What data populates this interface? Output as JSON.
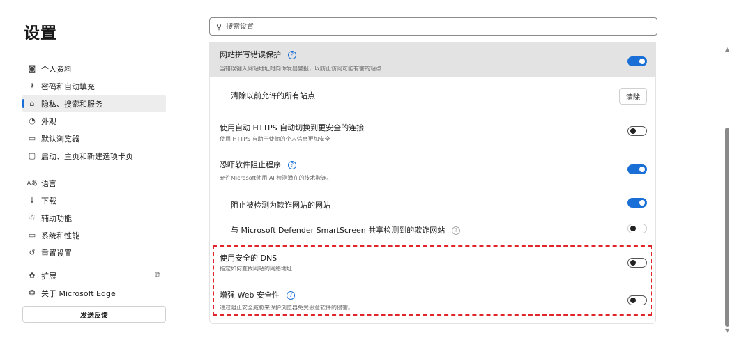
{
  "app": {
    "title": "设置"
  },
  "sidebar": {
    "items": [
      {
        "label": "个人资料",
        "icon": "profile-icon",
        "glyph": "◙"
      },
      {
        "label": "密码和自动填充",
        "icon": "key-icon",
        "glyph": "⚷"
      },
      {
        "label": "隐私、搜索和服务",
        "icon": "lock-icon",
        "glyph": "⌂",
        "active": true
      },
      {
        "label": "外观",
        "icon": "appearance-icon",
        "glyph": "◔"
      },
      {
        "label": "默认浏览器",
        "icon": "browser-icon",
        "glyph": "▭"
      },
      {
        "label": "启动、主页和新建选项卡页",
        "icon": "home-tab-icon",
        "glyph": "▢"
      },
      {
        "label": "语言",
        "icon": "language-icon",
        "glyph": "Aあ"
      },
      {
        "label": "下载",
        "icon": "download-icon",
        "glyph": "↓"
      },
      {
        "label": "辅助功能",
        "icon": "accessibility-icon",
        "glyph": "☃"
      },
      {
        "label": "系统和性能",
        "icon": "system-icon",
        "glyph": "▭"
      },
      {
        "label": "重置设置",
        "icon": "reset-icon",
        "glyph": "↺"
      },
      {
        "label": "扩展",
        "icon": "extension-icon",
        "glyph": "✿"
      },
      {
        "label": "关于 Microsoft Edge",
        "icon": "edge-icon",
        "glyph": "❂"
      }
    ],
    "feedback_label": "发送反馈"
  },
  "search": {
    "placeholder": "搜索设置"
  },
  "settings": {
    "typo": {
      "title": "网站拼写错误保护",
      "desc": "当错误键入网站地址时向你发出警报，以防止访问可能有害的站点",
      "on": true
    },
    "clear_sites": {
      "title": "清除以前允许的所有站点",
      "button": "清除"
    },
    "https": {
      "title": "使用自动 HTTPS 自动切换到更安全的连接",
      "desc": "使用 HTTPS 有助于使你的个人信息更加安全",
      "on": false
    },
    "scareware": {
      "title": "恐吓软件阻止程序",
      "desc": "允许Microsoft使用 AI 检测潜在的技术欺诈。",
      "on": true
    },
    "block_scam": {
      "title": "阻止被检测为欺诈网站的网站",
      "on": true
    },
    "smartscreen": {
      "title": "与 Microsoft Defender SmartScreen 共享检测到的欺诈网站",
      "on": false
    },
    "secure_dns": {
      "title": "使用安全的 DNS",
      "desc": "指定如何查找网站的网络地址",
      "on": false
    },
    "web_security": {
      "title": "增强 Web 安全性",
      "desc": "通过阻止安全威胁来保护浏览器免受恶意软件的侵害。",
      "on": false
    }
  },
  "colors": {
    "accent": "#1a6fd6",
    "highlight_box": "#e0262b"
  }
}
